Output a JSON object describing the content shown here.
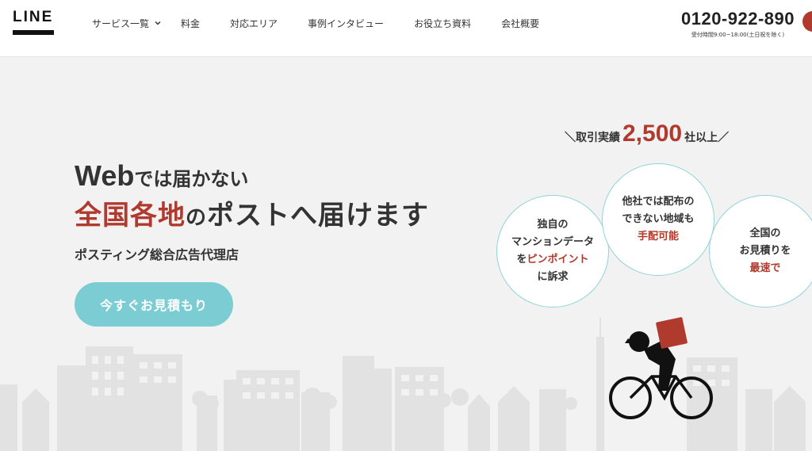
{
  "header": {
    "logo": "LINE",
    "nav": [
      {
        "label": "サービス一覧"
      },
      {
        "label": "料金"
      },
      {
        "label": "対応エリア"
      },
      {
        "label": "事例インタビュー"
      },
      {
        "label": "お役立ち資料"
      },
      {
        "label": "会社概要"
      }
    ],
    "phone": "0120-922-890",
    "hours": "受付時間9:00~18:00(土日祝を除く)"
  },
  "hero": {
    "line1_big": "Web",
    "line1_rest": "では届かない",
    "line2_accent": "全国各地",
    "line2_mid": "の",
    "line2_rest": "ポストへ届けます",
    "subtitle": "ポスティング総合広告代理店",
    "cta": "今すぐお見積もり"
  },
  "achievement": {
    "prefix": "＼取引実績",
    "number": "2,500",
    "suffix": "社以上／"
  },
  "bubbles": [
    {
      "lines": [
        "独自の",
        "マンションデータ"
      ],
      "accent": "ピンポイント",
      "accent_pre": "を",
      "after": "に訴求"
    },
    {
      "lines": [
        "他社では配布の",
        "できない地域も"
      ],
      "accent": "手配可能"
    },
    {
      "lines": [
        "全国の",
        "お見積りを"
      ],
      "accent": "最速で"
    }
  ],
  "colors": {
    "accent": "#b03a2e",
    "teal": "#7ccdd3",
    "background": "#f2f2f2"
  }
}
